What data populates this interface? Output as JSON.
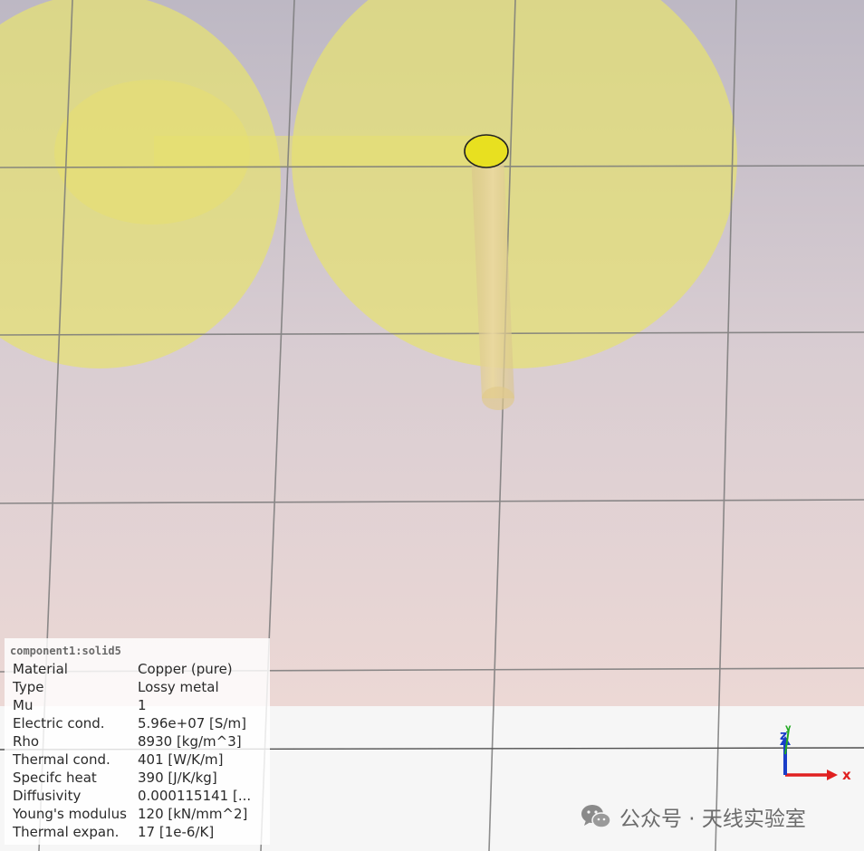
{
  "viewport": {
    "background_top": "#bdb8c4",
    "background_bottom": "#ead7d4",
    "floor_color": "#f6f6f6",
    "pad_color": "#e6e272",
    "pin_color": "#e8e020",
    "via_color": "#e0c98a"
  },
  "properties_panel": {
    "title": "component1:solid5",
    "rows": [
      {
        "key": "Material",
        "value": "Copper (pure)"
      },
      {
        "key": "Type",
        "value": "Lossy metal"
      },
      {
        "key": "Mu",
        "value": "1"
      },
      {
        "key": "Electric cond.",
        "value": "5.96e+07 [S/m]"
      },
      {
        "key": "Rho",
        "value": "8930 [kg/m^3]"
      },
      {
        "key": "Thermal cond.",
        "value": "401 [W/K/m]"
      },
      {
        "key": "Specifc heat",
        "value": "390 [J/K/kg]"
      },
      {
        "key": "Diffusivity",
        "value": "0.000115141 [..."
      },
      {
        "key": "Young's modulus",
        "value": "120 [kN/mm^2]"
      },
      {
        "key": "Thermal expan.",
        "value": "17 [1e-6/K]"
      }
    ]
  },
  "axes": {
    "x_label": "x",
    "y_label": "y",
    "z_label": "z",
    "x_color": "#e02020",
    "y_color": "#22aa22",
    "z_color": "#1a3ec8"
  },
  "watermark": {
    "icon": "wechat-icon",
    "text": "公众号 · 天线实验室"
  }
}
